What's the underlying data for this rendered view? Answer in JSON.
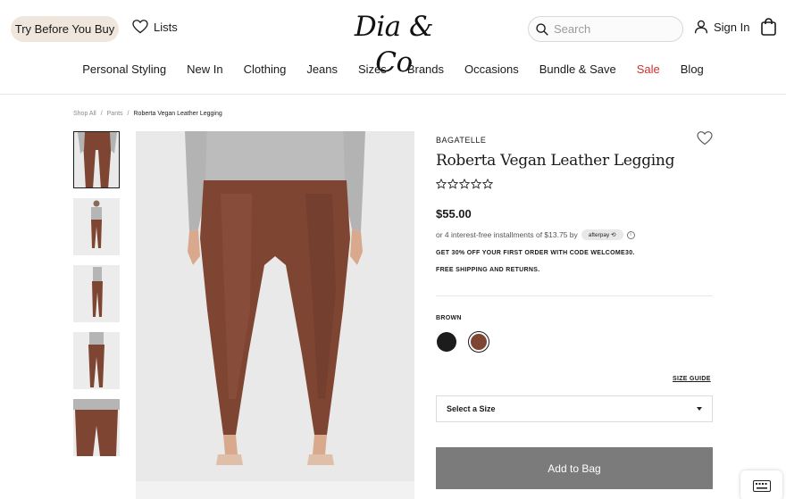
{
  "header": {
    "try_before_label": "Try Before You Buy",
    "lists_label": "Lists",
    "logo_text": "Dia & Co",
    "search_placeholder": "Search",
    "signin_label": "Sign In"
  },
  "nav": {
    "items": [
      "Personal Styling",
      "New In",
      "Clothing",
      "Jeans",
      "Sizes",
      "Brands",
      "Occasions",
      "Bundle & Save",
      "Sale",
      "Blog"
    ],
    "sale_color": "#d0302f"
  },
  "breadcrumb": {
    "items": [
      "Shop All",
      "Pants",
      "Roberta Vegan Leather Legging"
    ]
  },
  "product": {
    "brand": "BAGATELLE",
    "title": "Roberta Vegan Leather Legging",
    "rating_stars": 0,
    "price": "$55.00",
    "installments_text": "or 4 interest-free installments of $13.75 by",
    "afterpay_label": "afterpay",
    "promo_text": "GET 30% OFF YOUR FIRST ORDER WITH CODE WELCOME30.",
    "shipping_text": "FREE SHIPPING AND RETURNS.",
    "color_label": "BROWN",
    "colors": [
      "#1c1c1c",
      "#7e4532"
    ],
    "size_guide_label": "SIZE GUIDE",
    "size_select_label": "Select a Size",
    "add_to_bag_label": "Add to Bag",
    "legging_color": "#7e4532"
  }
}
